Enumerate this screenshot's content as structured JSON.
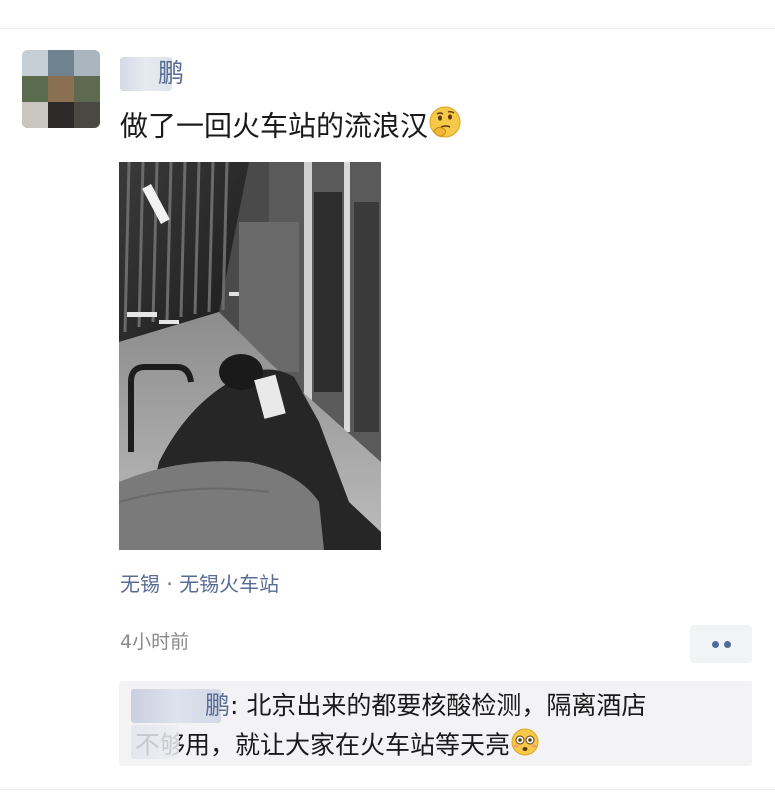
{
  "post": {
    "author_name_visible": "鹏",
    "text": "做了一回火车站的流浪汉",
    "text_emoji": "thinking-face-emoji",
    "photo": "black-and-white-train-station-legs-on-bench-photo",
    "location": "无锡 · 无锡火车站",
    "timestamp": "4小时前"
  },
  "more_button": {
    "icon": "two-dots-icon"
  },
  "comment": {
    "commenter_visible": "鹏",
    "separator": ": ",
    "line1": "北京出来的都要核酸检测，隔离酒店",
    "line2": "不够用，就让大家在火车站等天亮",
    "emoji": "flushed-face-emoji"
  },
  "colors": {
    "link_blue": "#576b95",
    "text": "#1a1a1a",
    "meta_gray": "#8a8a8a",
    "comment_bg": "#f3f3f5"
  }
}
